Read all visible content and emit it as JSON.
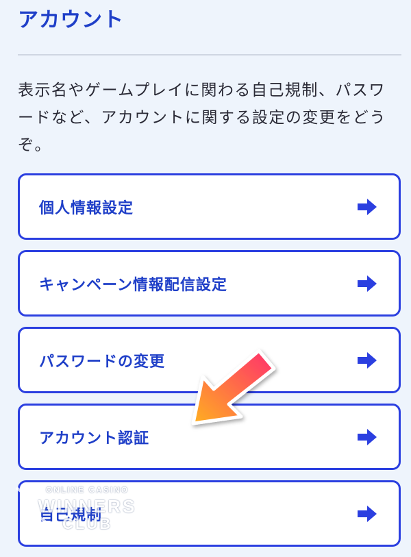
{
  "header": {
    "title": "アカウント"
  },
  "description": "表示名やゲームプレイに関わる自己規制、パスワードなど、アカウントに関する設定の変更をどうぞ。",
  "menu": {
    "items": [
      {
        "label": "個人情報設定",
        "icon": "arrow-right-icon"
      },
      {
        "label": "キャンペーン情報配信設定",
        "icon": "arrow-right-icon"
      },
      {
        "label": "パスワードの変更",
        "icon": "arrow-right-icon"
      },
      {
        "label": "アカウント認証",
        "icon": "arrow-right-icon"
      },
      {
        "label": "自己規制",
        "icon": "arrow-right-icon"
      }
    ]
  },
  "watermark": {
    "line1": "ONLINE CASINO",
    "line2": "WINNERS",
    "line3": "CLUB"
  },
  "colors": {
    "accent": "#1f3fc8",
    "border": "#2b3fe0",
    "background": "#eef4fc",
    "callout_gradient_top": "#ff2e6e",
    "callout_gradient_bottom": "#ffb020"
  }
}
